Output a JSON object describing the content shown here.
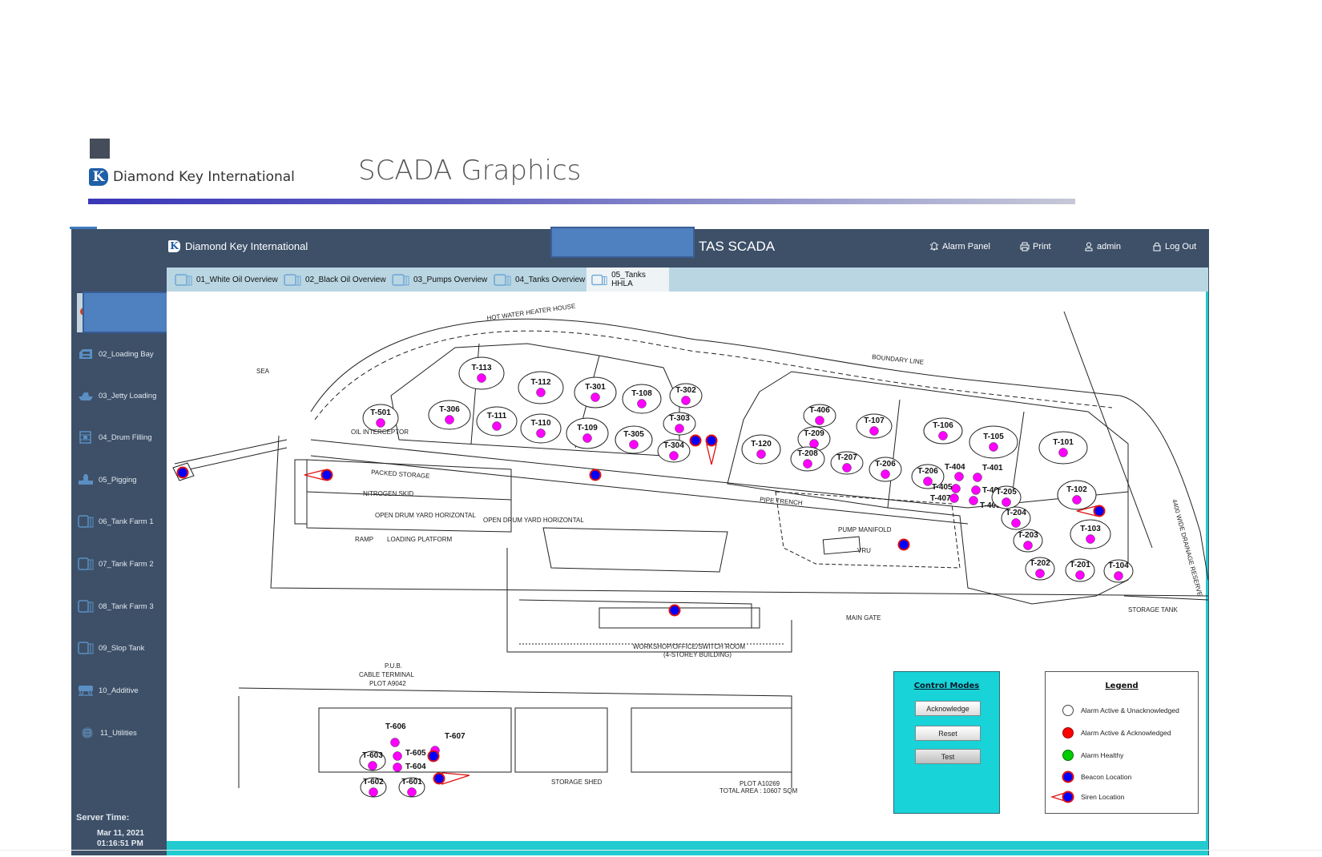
{
  "slide": {
    "company": "Diamond Key International",
    "logo_letter": "K",
    "title": "SCADA Graphics"
  },
  "app": {
    "brand": "Diamond Key International",
    "title": "TAS SCADA",
    "top_nav": [
      {
        "label": "Alarm Panel",
        "icon": "alarm-bell-icon"
      },
      {
        "label": "Print",
        "icon": "printer-icon"
      },
      {
        "label": "admin",
        "icon": "user-icon"
      },
      {
        "label": "Log Out",
        "icon": "lock-icon"
      }
    ],
    "tabs": [
      {
        "label": "01_White Oil Overview",
        "active": false
      },
      {
        "label": "02_Black Oil Overview",
        "active": false
      },
      {
        "label": "03_Pumps Overview",
        "active": false
      },
      {
        "label": "04_Tanks Overview",
        "active": false
      },
      {
        "label": "05_Tanks HHLA",
        "active": true
      }
    ],
    "sidebar": [
      {
        "label": "02_Loading Bay",
        "icon": "truck-icon"
      },
      {
        "label": "03_Jetty Loading",
        "icon": "ship-icon"
      },
      {
        "label": "04_Drum Filling",
        "icon": "drum-icon"
      },
      {
        "label": "05_Pigging",
        "icon": "pipe-valve-icon"
      },
      {
        "label": "06_Tank Farm 1",
        "icon": "tank-icon"
      },
      {
        "label": "07_Tank Farm 2",
        "icon": "tank-icon"
      },
      {
        "label": "08_Tank Farm 3",
        "icon": "tank-icon"
      },
      {
        "label": "09_Slop Tank",
        "icon": "tank-icon"
      },
      {
        "label": "10_Additive",
        "icon": "additive-tank-icon"
      },
      {
        "label": "11_Utilities",
        "icon": "utilities-icon"
      }
    ],
    "server_time": {
      "label": "Server Time:",
      "date": "Mar 11, 2021",
      "time": "01:16:51 PM"
    }
  },
  "control_modes": {
    "title": "Control Modes",
    "buttons": [
      "Acknowledge",
      "Reset",
      "Test"
    ]
  },
  "legend": {
    "title": "Legend",
    "items": [
      {
        "label": "Alarm Active & Unacknowledged",
        "color": "#ffffff"
      },
      {
        "label": "Alarm Active & Acknowledged",
        "color": "#ff0000"
      },
      {
        "label": "Alarm Healthy",
        "color": "#00cc00"
      },
      {
        "label": "Beacon Location",
        "color": "#0000ff"
      },
      {
        "label": "Siren Location",
        "color": "#0000ff"
      }
    ]
  },
  "colors": {
    "tank_status": "#ff00ff",
    "beacon": "#0000ff",
    "beacon_ring": "#e01010",
    "panel_cyan": "#18d3d8"
  },
  "map": {
    "area_labels": {
      "sea": "SEA",
      "hot_water": "HOT WATER HEATER HOUSE",
      "boundary": "BOUNDARY LINE",
      "packed_storage": "PACKED STORAGE",
      "nitrogen": "NITROGEN SKID",
      "drum_yard_1": "OPEN DRUM YARD HORIZONTAL",
      "drum_yard_2": "OPEN DRUM YARD HORIZONTAL",
      "ramp": "RAMP",
      "loading_platform": "LOADING PLATFORM",
      "pipe_trench": "PIPE TRENCH",
      "pump_manifold": "PUMP MANIFOLD",
      "vru": "VRU",
      "main_gate": "MAIN GATE",
      "storage_tank": "STORAGE TANK",
      "workshop": "WORKSHOP/OFFICE/SWITCH ROOM",
      "workshop_sub": "(4-STOREY BUILDING)",
      "pub_1": "P.U.B.",
      "pub_2": "CABLE TERMINAL",
      "pub_3": "PLOT A9042",
      "plot": "PLOT A10269",
      "total_area": "TOTAL AREA : 10607 SQM",
      "storage_shed": "STORAGE SHED",
      "oil_interceptor": "OIL INTERCEPTOR",
      "drainage": "4400 WIDE DRAINAGE RESERVE"
    },
    "tanks": [
      {
        "id": "T-113"
      },
      {
        "id": "T-112"
      },
      {
        "id": "T-301"
      },
      {
        "id": "T-108"
      },
      {
        "id": "T-302"
      },
      {
        "id": "T-306"
      },
      {
        "id": "T-111"
      },
      {
        "id": "T-110"
      },
      {
        "id": "T-109"
      },
      {
        "id": "T-305"
      },
      {
        "id": "T-303"
      },
      {
        "id": "T-304"
      },
      {
        "id": "T-501"
      },
      {
        "id": "T-406"
      },
      {
        "id": "T-107"
      },
      {
        "id": "T-209"
      },
      {
        "id": "T-120"
      },
      {
        "id": "T-208"
      },
      {
        "id": "T-207"
      },
      {
        "id": "T-206"
      },
      {
        "id": "T-106"
      },
      {
        "id": "T-105"
      },
      {
        "id": "T-101"
      },
      {
        "id": "T-206"
      },
      {
        "id": "T-404"
      },
      {
        "id": "T-401"
      },
      {
        "id": "T-405"
      },
      {
        "id": "T-402"
      },
      {
        "id": "T-407"
      },
      {
        "id": "T-403"
      },
      {
        "id": "T-205"
      },
      {
        "id": "T-102"
      },
      {
        "id": "T-204"
      },
      {
        "id": "T-103"
      },
      {
        "id": "T-203"
      },
      {
        "id": "T-202"
      },
      {
        "id": "T-201"
      },
      {
        "id": "T-104"
      },
      {
        "id": "T-606"
      },
      {
        "id": "T-603"
      },
      {
        "id": "T-605"
      },
      {
        "id": "T-604"
      },
      {
        "id": "T-607"
      },
      {
        "id": "T-602"
      },
      {
        "id": "T-601"
      }
    ]
  }
}
